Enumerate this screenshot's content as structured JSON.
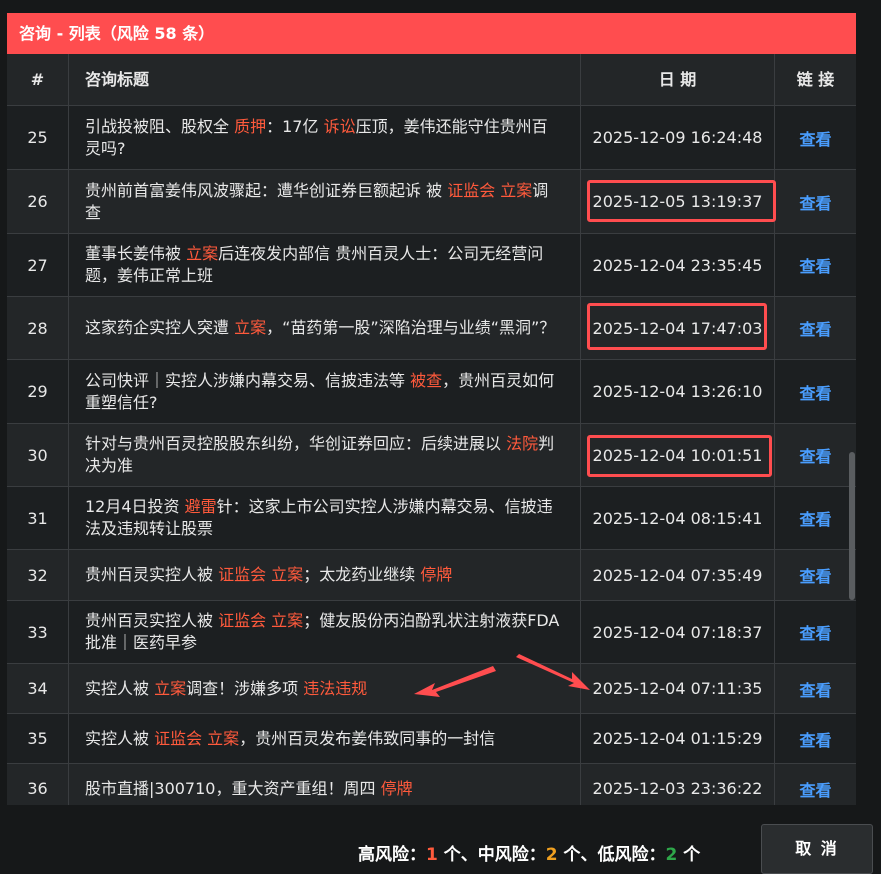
{
  "dialog": {
    "title": "咨询 - 列表（风险 58 条）"
  },
  "table": {
    "headers": {
      "index": "#",
      "title": "咨询标题",
      "date": "日 期",
      "link": "链 接"
    },
    "rows": [
      {
        "index": "25",
        "title": [
          {
            "t": "引战投被阻、股权全 "
          },
          {
            "t": "质押",
            "r": true
          },
          {
            "t": "：17亿 "
          },
          {
            "t": "诉讼",
            "r": true
          },
          {
            "t": "压顶，姜伟还能守住贵州百灵吗?"
          }
        ],
        "date": "2025-12-09 16:24:48",
        "link": "查看",
        "highlight": false
      },
      {
        "index": "26",
        "title": [
          {
            "t": "贵州前首富姜伟风波骤起：遭华创证券巨额起诉 被 "
          },
          {
            "t": "证监会 立案",
            "r": true
          },
          {
            "t": "调查"
          }
        ],
        "date": "2025-12-05 13:19:37",
        "link": "查看",
        "highlight": true
      },
      {
        "index": "27",
        "title": [
          {
            "t": "董事长姜伟被 "
          },
          {
            "t": "立案",
            "r": true
          },
          {
            "t": "后连夜发内部信 贵州百灵人士：公司无经营问题，姜伟正常上班"
          }
        ],
        "date": "2025-12-04 23:35:45",
        "link": "查看",
        "highlight": false
      },
      {
        "index": "28",
        "title": [
          {
            "t": "这家药企实控人突遭 "
          },
          {
            "t": "立案",
            "r": true
          },
          {
            "t": "，“苗药第一股”深陷治理与业绩“黑洞”？"
          }
        ],
        "date": "2025-12-04 17:47:03",
        "link": "查看",
        "highlight": true
      },
      {
        "index": "29",
        "title": [
          {
            "t": "公司快评｜实控人涉嫌内幕交易、信披违法等 "
          },
          {
            "t": "被查",
            "r": true
          },
          {
            "t": "，贵州百灵如何重塑信任?"
          }
        ],
        "date": "2025-12-04 13:26:10",
        "link": "查看",
        "highlight": false
      },
      {
        "index": "30",
        "title": [
          {
            "t": "针对与贵州百灵控股股东纠纷，华创证券回应：后续进展以 "
          },
          {
            "t": "法院",
            "r": true
          },
          {
            "t": "判决为准"
          }
        ],
        "date": "2025-12-04 10:01:51",
        "link": "查看",
        "highlight": true
      },
      {
        "index": "31",
        "title": [
          {
            "t": "12月4日投资 "
          },
          {
            "t": "避雷",
            "r": true
          },
          {
            "t": "针：这家上市公司实控人涉嫌内幕交易、信披违法及违规转让股票"
          }
        ],
        "date": "2025-12-04 08:15:41",
        "link": "查看",
        "highlight": false
      },
      {
        "index": "32",
        "title": [
          {
            "t": "贵州百灵实控人被 "
          },
          {
            "t": "证监会 立案",
            "r": true
          },
          {
            "t": "；太龙药业继续 "
          },
          {
            "t": "停牌",
            "r": true
          }
        ],
        "date": "2025-12-04 07:35:49",
        "link": "查看",
        "highlight": false
      },
      {
        "index": "33",
        "title": [
          {
            "t": "贵州百灵实控人被 "
          },
          {
            "t": "证监会 立案",
            "r": true
          },
          {
            "t": "；健友股份丙泊酚乳状注射液获FDA批准｜医药早参"
          }
        ],
        "date": "2025-12-04 07:18:37",
        "link": "查看",
        "highlight": false
      },
      {
        "index": "34",
        "title": [
          {
            "t": "实控人被 "
          },
          {
            "t": "立案",
            "r": true
          },
          {
            "t": "调查！涉嫌多项 "
          },
          {
            "t": "违法违规",
            "r": true
          }
        ],
        "date": "2025-12-04 07:11:35",
        "link": "查看",
        "highlight": false
      },
      {
        "index": "35",
        "title": [
          {
            "t": "实控人被 "
          },
          {
            "t": "证监会 立案",
            "r": true
          },
          {
            "t": "，贵州百灵发布姜伟致同事的一封信"
          }
        ],
        "date": "2025-12-04 01:15:29",
        "link": "查看",
        "highlight": false
      },
      {
        "index": "36",
        "title": [
          {
            "t": "股市直播|300710，重大资产重组！周四 "
          },
          {
            "t": "停牌",
            "r": true
          }
        ],
        "date": "2025-12-03 23:36:22",
        "link": "查看",
        "highlight": false
      }
    ]
  },
  "summary": {
    "high_label": "高风险：",
    "high_count": "1",
    "high_unit": " 个、",
    "mid_label": "中风险：",
    "mid_count": "2",
    "mid_unit": " 个、",
    "low_label": "低风险：",
    "low_count": "2",
    "low_unit": " 个"
  },
  "buttons": {
    "cancel": "取 消"
  },
  "colors": {
    "header_bg": "#ff4d4f",
    "risk_text": "#ff5a3c",
    "link": "#4a9eff",
    "mid": "#f0a020",
    "low": "#2ea84a"
  }
}
